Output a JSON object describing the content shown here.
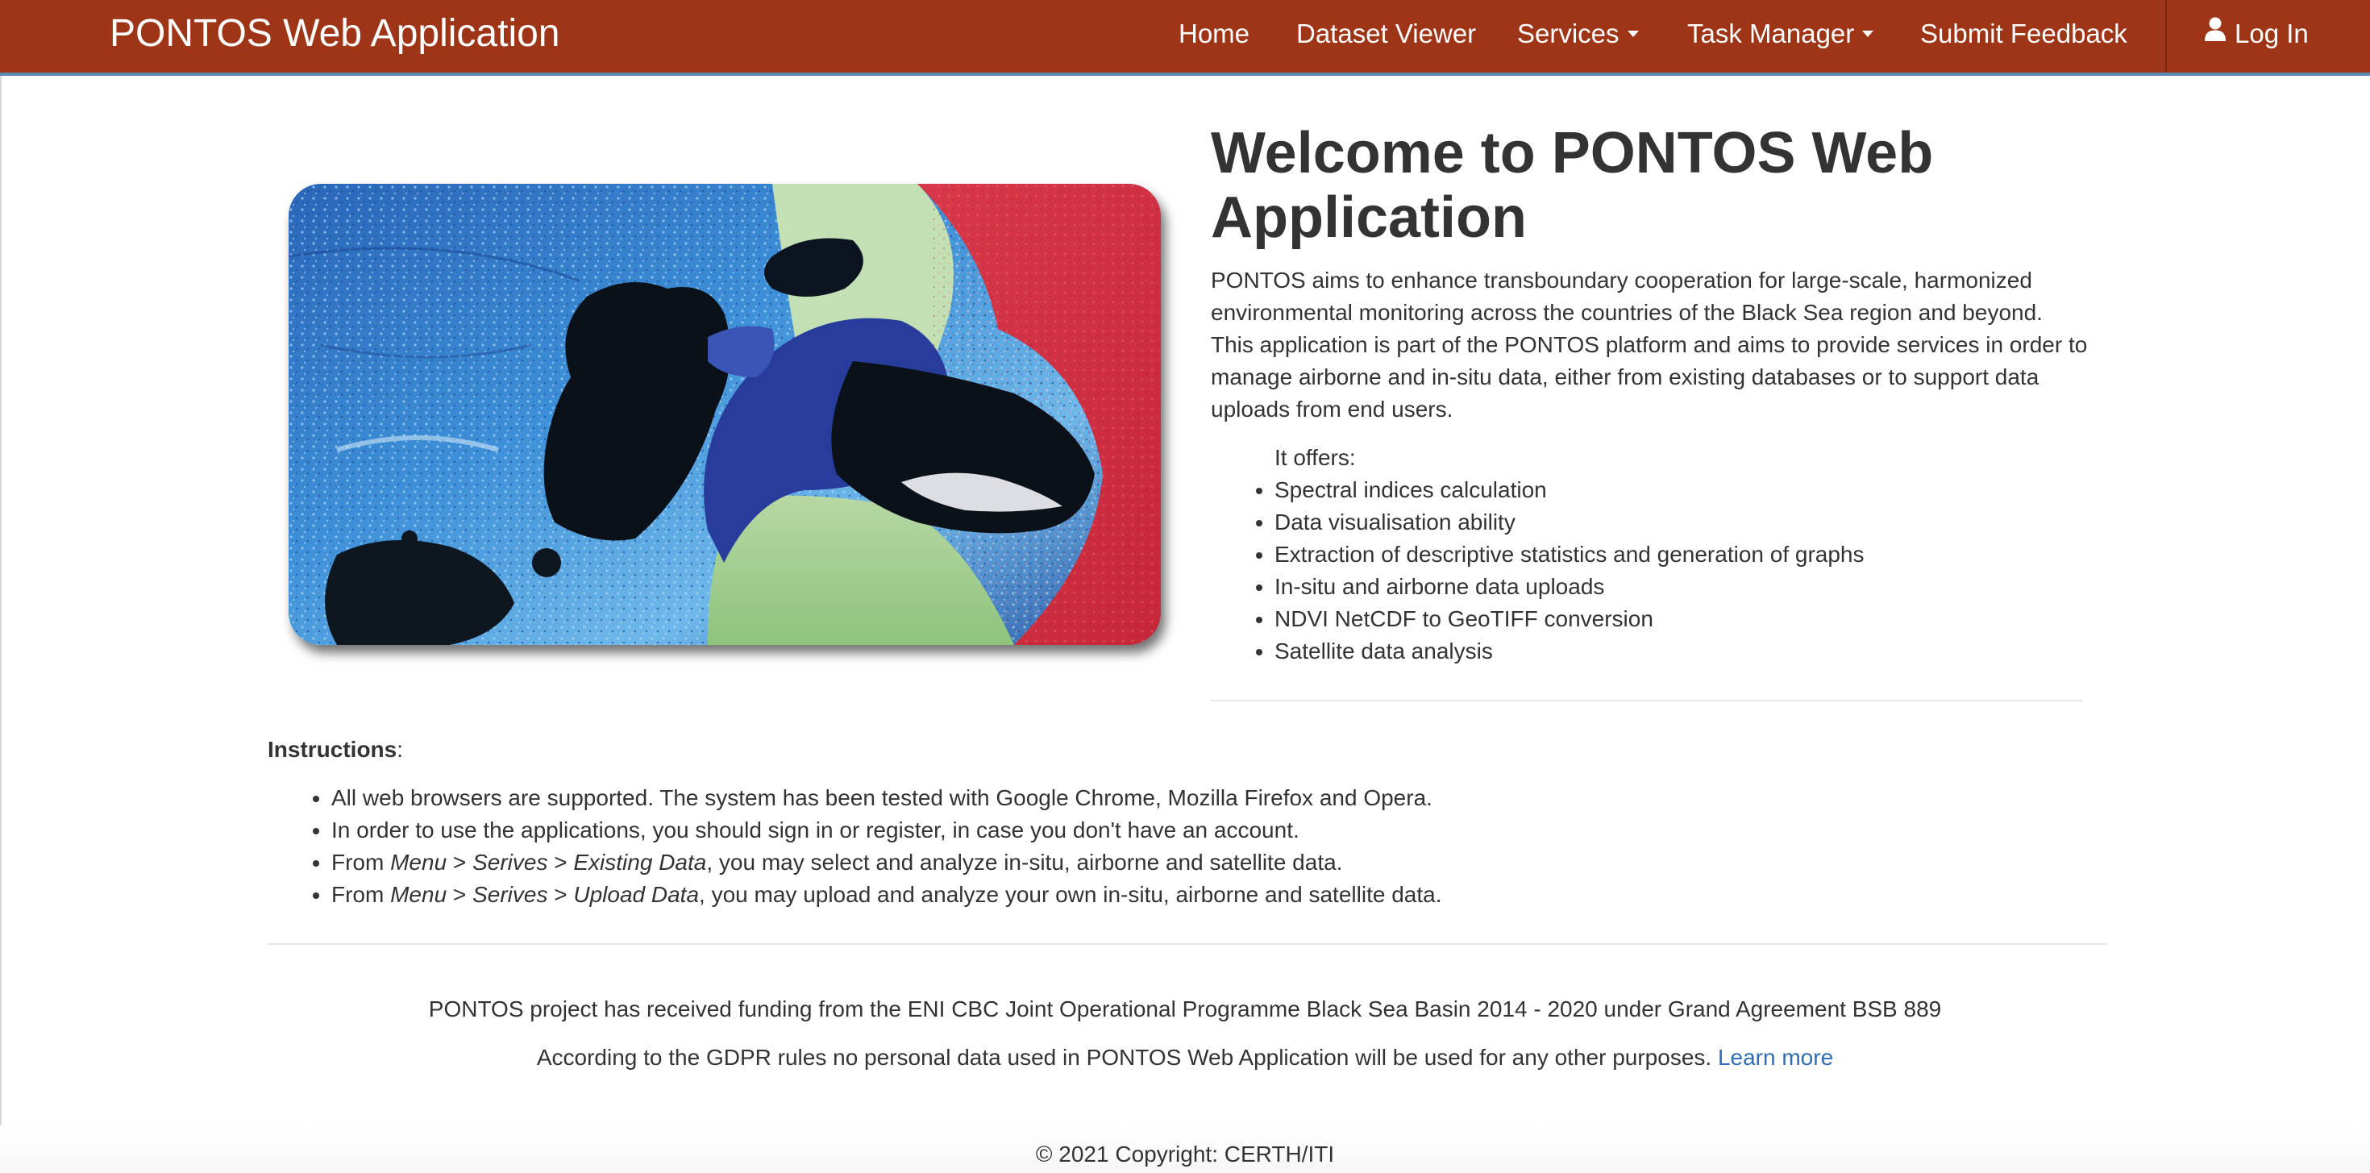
{
  "navbar": {
    "brand": "PONTOS Web Application",
    "items": [
      {
        "label": "Home"
      },
      {
        "label": "Dataset Viewer"
      },
      {
        "label": "Services"
      },
      {
        "label": "Task Manager"
      },
      {
        "label": "Submit Feedback"
      }
    ],
    "login_label": "Log In",
    "colors": {
      "background": "#9e3517",
      "accent_border": "#5b87b5"
    }
  },
  "welcome": {
    "title": "Welcome to PONTOS Web Application",
    "intro": "PONTOS aims to enhance transboundary cooperation for large-scale, harmonized environmental monitoring across the countries of the Black Sea region and beyond. This application is part of the PONTOS platform and aims to provide services in order to manage airborne and in-situ data, either from existing databases or to support data uploads from end users.",
    "offers_label": "It offers:",
    "offers": [
      "Spectral indices calculation",
      "Data visualisation ability",
      "Extraction of descriptive statistics and generation of graphs",
      "In-situ and airborne data uploads",
      "NDVI NetCDF to GeoTIFF conversion",
      "Satellite data analysis"
    ]
  },
  "instructions": {
    "title": "Instructions",
    "suffix": ":",
    "items": [
      {
        "parts": [
          "All web browsers are supported. The system has been tested with Google Chrome, Mozilla Firefox and Opera."
        ]
      },
      {
        "parts": [
          "In order to use the applications, you should sign in or register, in case you don't have an account."
        ]
      },
      {
        "pre": "From ",
        "menu": "Menu",
        "sep1": " > ",
        "services": "Serives",
        "sep2": " > ",
        "target": "Existing Data",
        "post": ", you may select and analyze in-situ, airborne and satellite data."
      },
      {
        "pre": "From ",
        "menu": "Menu",
        "sep1": " > ",
        "services": "Serives",
        "sep2": " > ",
        "target": "Upload Data",
        "post": ", you may upload and analyze your own in-situ, airborne and satellite data."
      }
    ]
  },
  "footer": {
    "funding": "PONTOS project has received funding from the ENI CBC Joint Operational Programme Black Sea Basin 2014 - 2020 under Grand Agreement BSB 889",
    "gdpr": "According to the GDPR rules no personal data used in PONTOS Web Application will be used for any other purposes.",
    "learn_more": "Learn more",
    "copyright": "© 2021 Copyright: CERTH/ITI"
  }
}
